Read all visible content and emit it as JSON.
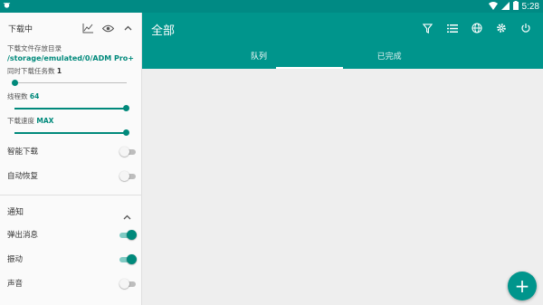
{
  "statusbar": {
    "time": "5:28"
  },
  "toolbar": {
    "title": "全部",
    "actions": [
      "filter-icon",
      "list-icon",
      "globe-icon",
      "settings-icon",
      "power-icon"
    ]
  },
  "tabs": [
    {
      "label": "队列",
      "active": true
    },
    {
      "label": "已完成",
      "active": false
    }
  ],
  "drawer": {
    "header": "下载中",
    "folder_label": "下载文件存放目录",
    "folder_path": "/storage/emulated/0/ADM Pro+",
    "tasks_label": "同时下载任务数",
    "tasks_value": "1",
    "threads_label": "线程数",
    "threads_value": "64",
    "speed_label": "下载速度",
    "speed_value": "MAX",
    "toggles": [
      {
        "label": "智能下载",
        "on": false
      },
      {
        "label": "自动恢复",
        "on": false
      }
    ],
    "notify_header": "通知",
    "notify_toggles": [
      {
        "label": "弹出消息",
        "on": true
      },
      {
        "label": "振动",
        "on": true
      },
      {
        "label": "声音",
        "on": false
      }
    ]
  },
  "fab": {
    "label": "+"
  },
  "colors": {
    "primary": "#00958c",
    "accent": "#00897b",
    "statusbar": "#008a84"
  }
}
